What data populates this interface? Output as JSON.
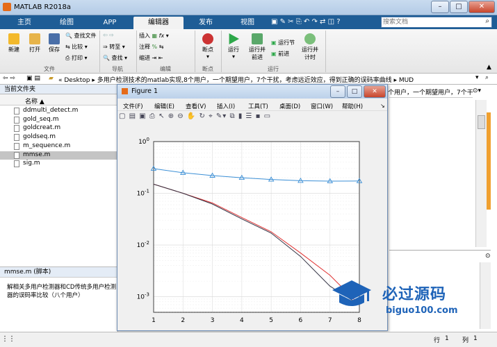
{
  "window": {
    "title": "MATLAB R2018a"
  },
  "tabs": [
    "主页",
    "绘图",
    "APP",
    "编辑器",
    "发布",
    "视图"
  ],
  "search": {
    "placeholder": "搜索文档"
  },
  "ribbon": {
    "file": {
      "new": "新建",
      "open": "打开",
      "save": "保存",
      "find_files": "查找文件",
      "compare": "比较",
      "print": "打印",
      "group": "文件"
    },
    "nav": {
      "goto": "转至",
      "find": "查找",
      "group": "导航"
    },
    "edit": {
      "insert": "插入",
      "comment": "注释",
      "indent": "缩进",
      "group": "编辑"
    },
    "breakpoints": {
      "label": "断点",
      "group": "断点"
    },
    "run": {
      "run": "运行",
      "run_advance": "运行并\n前进",
      "run_section": "运行节",
      "advance": "前进",
      "run_time": "运行并\n计时",
      "group": "运行"
    }
  },
  "address": {
    "path": "« Desktop ▸ 多用户检测技术的matlab实现,8个用户，一个期望用户，7个干扰，考虑远近效应，得到正确的误码率曲线 ▸ MUD"
  },
  "current_folder": {
    "title": "当前文件夹",
    "col_name": "名称 ▲",
    "files": [
      "ddmulti_detect.m",
      "gold_seq.m",
      "goldcreat.m",
      "goldseq.m",
      "m_sequence.m",
      "mmse.m",
      "sig.m"
    ],
    "selected_index": 5
  },
  "details": {
    "title": "mmse.m  (脚本)",
    "desc": "解相关多用户检测器和CD传统多用户检测器的误码率比较（八个用户）"
  },
  "figure": {
    "title": "Figure 1",
    "menu": [
      "文件(F)",
      "编辑(E)",
      "查看(V)",
      "插入(I)",
      "工具(T)",
      "桌面(D)",
      "窗口(W)",
      "帮助(H)"
    ]
  },
  "right_text": "个用户，一个期望用户，7个干",
  "status": {
    "row_label": "行",
    "row": "1",
    "col_label": "列",
    "col": "1"
  },
  "watermark": {
    "text1": "必过源码",
    "text2": "biguo100.com"
  },
  "chart_data": {
    "type": "line",
    "x": [
      1,
      2,
      3,
      4,
      5,
      6,
      7,
      8
    ],
    "xlim": [
      1,
      8
    ],
    "ylim": [
      0.0005,
      1
    ],
    "yscale": "log",
    "xticks": [
      "1",
      "2",
      "3",
      "4",
      "5",
      "6",
      "7",
      "8"
    ],
    "yticks": [
      "10^0",
      "10^-1",
      "10^-2",
      "10^-3"
    ],
    "grid": true,
    "series": [
      {
        "color": "#3b8fd6",
        "marker": "triangle",
        "values": [
          0.3,
          0.25,
          0.22,
          0.2,
          0.185,
          0.175,
          0.172,
          0.173
        ]
      },
      {
        "color": "#e03030",
        "marker": "none",
        "values": [
          0.15,
          0.1,
          0.065,
          0.034,
          0.018,
          0.007,
          0.0026,
          0.0007
        ]
      },
      {
        "color": "#333344",
        "marker": "none",
        "values": [
          0.15,
          0.1,
          0.062,
          0.032,
          0.017,
          0.006,
          0.0016,
          0.0007
        ]
      }
    ]
  }
}
